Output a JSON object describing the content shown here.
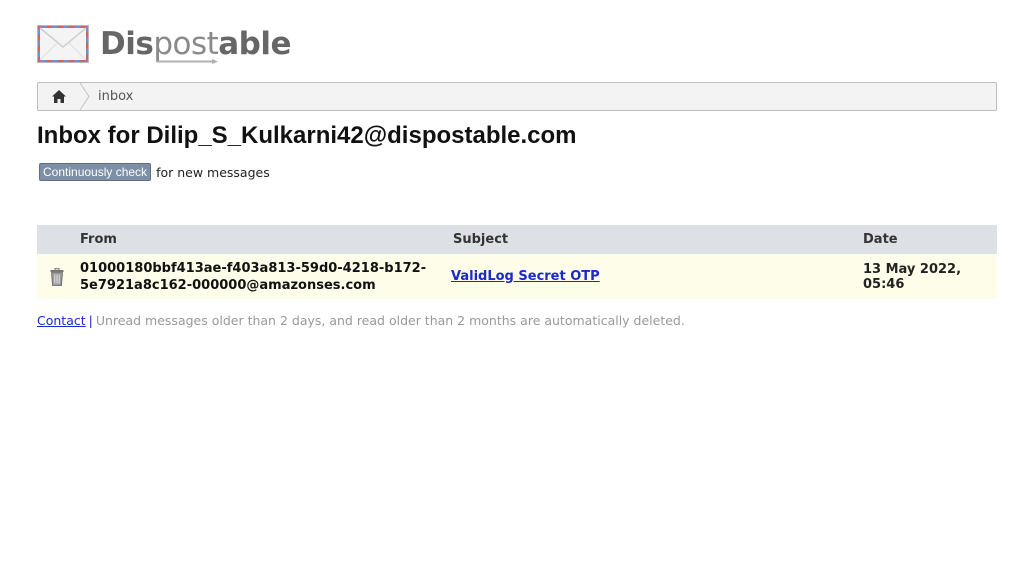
{
  "site": {
    "logo_text_pre": "Dis",
    "logo_text_mid": "post",
    "logo_text_post": "able",
    "logo_icon": "envelope-icon"
  },
  "breadcrumb": {
    "home_icon": "home-icon",
    "current": "inbox"
  },
  "page": {
    "title": "Inbox for Dilip_S_Kulkarni42@dispostable.com"
  },
  "check": {
    "button_label": "Continuously check",
    "suffix": "for new messages"
  },
  "table": {
    "headers": {
      "from": "From",
      "subject": "Subject",
      "date": "Date"
    },
    "rows": [
      {
        "from_line1": "01000180bbf413ae-f403a813-59d0-4218-b172-",
        "from_line2": "5e7921a8c162-000000@amazonses.com",
        "subject": "ValidLog Secret OTP",
        "date": "13 May 2022, 05:46"
      }
    ]
  },
  "footer": {
    "contact": "Contact",
    "separator": "|",
    "notice": "Unread messages older than 2 days, and read older than 2 months are automatically deleted."
  },
  "colors": {
    "link": "#1a2acb",
    "header_bg": "#dde1e6",
    "row_bg": "#fdfde9",
    "button_bg": "#7c8fa6"
  }
}
